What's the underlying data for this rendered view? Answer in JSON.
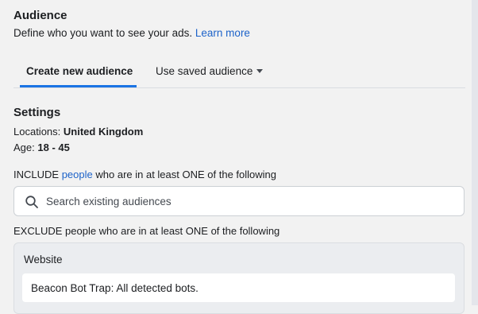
{
  "section": {
    "title": "Audience",
    "description": "Define who you want to see your ads.",
    "learn_more": "Learn more"
  },
  "tabs": [
    {
      "label": "Create new audience",
      "active": true
    },
    {
      "label": "Use saved audience",
      "active": false
    }
  ],
  "settings": {
    "title": "Settings",
    "locations_label": "Locations:",
    "locations_value": "United Kingdom",
    "age_label": "Age:",
    "age_value": "18 - 45"
  },
  "include": {
    "prefix": "INCLUDE",
    "link": "people",
    "suffix": "who are in at least ONE of the following",
    "search_placeholder": "Search existing audiences"
  },
  "exclude": {
    "text": "EXCLUDE people who are in at least ONE of the following",
    "group_title": "Website",
    "items": [
      "Beacon Bot Trap: All detected bots."
    ]
  },
  "colors": {
    "link": "#1d63c9",
    "active_tab": "#1b74e4"
  },
  "icons": {
    "search": "search-icon",
    "dropdown": "caret-down-icon"
  }
}
